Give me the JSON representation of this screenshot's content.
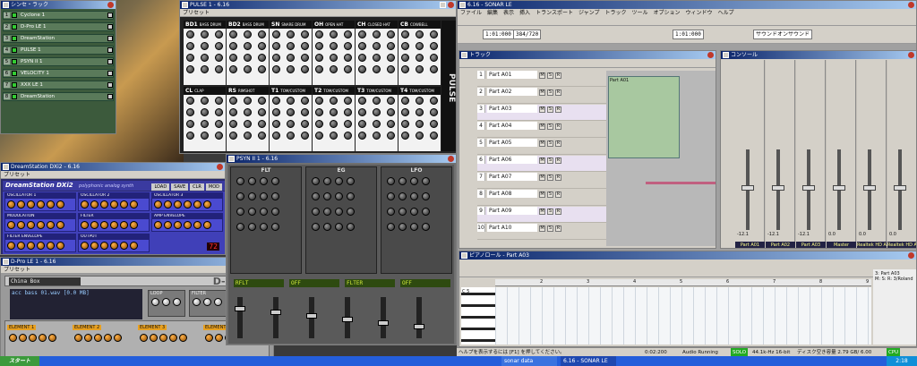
{
  "desktop": {
    "bg": "#3a3a3a"
  },
  "synth_rack": {
    "title": "シンセ・ラック",
    "items": [
      {
        "num": "1",
        "name": "Cyclone 1"
      },
      {
        "num": "2",
        "name": "D-Pro LE 1"
      },
      {
        "num": "3",
        "name": "DreamStation"
      },
      {
        "num": "4",
        "name": "PULSE 1"
      },
      {
        "num": "5",
        "name": "PSYN II 1"
      },
      {
        "num": "6",
        "name": "VELOCITY 1"
      },
      {
        "num": "7",
        "name": "XXX LE 1"
      },
      {
        "num": "8",
        "name": "DreamStation"
      }
    ]
  },
  "pulse": {
    "title": "PULSE 1 - 6.16",
    "preset_label": "プリセット",
    "brand": "PULSE",
    "brand_sub": "MODULAR DRUM SYNTH",
    "channels_top": [
      {
        "code": "BD1",
        "name": "BASS DRUM"
      },
      {
        "code": "BD2",
        "name": "BASS DRUM"
      },
      {
        "code": "SN",
        "name": "SNARE DRUM"
      },
      {
        "code": "OH",
        "name": "OPEN HAT"
      },
      {
        "code": "CH",
        "name": "CLOSED HAT"
      },
      {
        "code": "CB",
        "name": "COWBELL"
      }
    ],
    "channels_bottom": [
      {
        "code": "CL",
        "name": "CLAP"
      },
      {
        "code": "RS",
        "name": "RIMSHOT"
      },
      {
        "code": "T1",
        "name": "TOM/CUSTOM"
      },
      {
        "code": "T2",
        "name": "TOM/CUSTOM"
      },
      {
        "code": "T3",
        "name": "TOM/CUSTOM"
      },
      {
        "code": "T4",
        "name": "TOM/CUSTOM"
      }
    ]
  },
  "dreamstation": {
    "title": "DreamStation DXi2 - 6.16",
    "preset_label": "プリセット",
    "logo": "DreamStation DXi2",
    "logo_sub": "polyphonic analog synth",
    "buttons": [
      "LOAD",
      "SAVE",
      "CLR",
      "MOD"
    ],
    "sections": [
      "OSCILLATOR 1",
      "OSCILLATOR 2",
      "OSCILLATOR 3",
      "MODULATION",
      "FILTER",
      "AMP ENVELOPE",
      "FILTER ENVELOPE",
      "OUTPUT"
    ],
    "lcd": "72"
  },
  "dprole": {
    "title": "D-Pro LE 1 - 6.16",
    "preset_label": "プリセット",
    "patch": "China Box",
    "logo": "D-PROLE",
    "wav": "acc bass 01.wav  [0.0 MB]",
    "params": [
      "LOOP",
      "FILTER",
      "DRIVE"
    ],
    "elements": [
      "ELEMENT 1",
      "ELEMENT 2",
      "ELEMENT 3",
      "ELEMENT 4"
    ],
    "brand": "LinPlug"
  },
  "psyn": {
    "title": "PSYN II 1 - 6.16",
    "sections": [
      "FLT",
      "EG",
      "LFO"
    ],
    "lcd1": "RFLT",
    "lcd2": "OFF",
    "lcd3": "FLTER",
    "lcd4": "OFF"
  },
  "sonar": {
    "title": "6.16 - SONAR LE",
    "menu": [
      "ファイル",
      "編集",
      "表示",
      "挿入",
      "トランスポート",
      "ジャンプ",
      "トラック",
      "ツール",
      "オプション",
      "ウィンドウ",
      "ヘルプ"
    ],
    "time1": "1:01:000",
    "time2": "384/720",
    "time3": "1:01:000",
    "time4": "1:01:000",
    "send_label": "サウンドオンサウンド"
  },
  "track_view": {
    "title": "トラック",
    "tracks": [
      {
        "num": "1",
        "name": "Part A01"
      },
      {
        "num": "2",
        "name": "Part A02"
      },
      {
        "num": "3",
        "name": "Part A03"
      },
      {
        "num": "4",
        "name": "Part A04"
      },
      {
        "num": "5",
        "name": "Part A05"
      },
      {
        "num": "6",
        "name": "Part A06"
      },
      {
        "num": "7",
        "name": "Part A07"
      },
      {
        "num": "8",
        "name": "Part A08"
      },
      {
        "num": "9",
        "name": "Part A09"
      },
      {
        "num": "10",
        "name": "Part A10"
      }
    ],
    "clip_label": "Part A01"
  },
  "console": {
    "title": "コンソール",
    "strips": [
      "Part A01",
      "Part A02",
      "Part A03",
      "Master",
      "Realtek HD A",
      "Realtek HD A"
    ],
    "db": [
      "-12.1",
      "-12.1",
      "-12.1",
      "0.0",
      "0.0",
      "0.0"
    ]
  },
  "piano_roll": {
    "title": "ピアノロール - Part A03",
    "ruler": [
      "2",
      "3",
      "4",
      "5",
      "6",
      "7",
      "8",
      "9"
    ],
    "octave": "C 5",
    "side": [
      "3: Part A03",
      "M: S: R: 3/Roland 1"
    ]
  },
  "statusbar": {
    "help": "ヘルプを表示するには [F1] を押してください。",
    "time": "0:02:200",
    "state": "Audio Running",
    "solo": "SOLO",
    "fmt": "44.1k-Hz 16-bit",
    "disk": "ディスク空き容量 2.79 GB/ 6.00",
    "cpu": "CPU"
  },
  "taskbar": {
    "start": "スタート",
    "tasks": [
      "sonar data",
      "6.16 - SONAR LE"
    ],
    "clock": "2:18"
  }
}
